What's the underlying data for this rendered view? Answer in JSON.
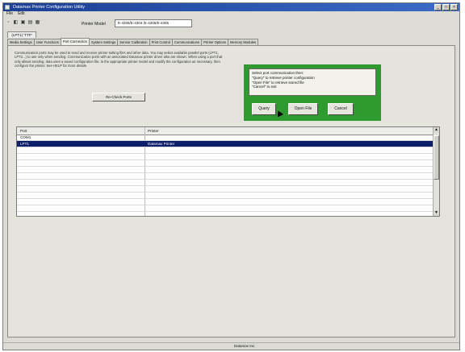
{
  "window": {
    "title": "Datamax Printer Configuration Utility",
    "controls": [
      "_",
      "□",
      "×"
    ]
  },
  "menu": [
    "File",
    "Edit"
  ],
  "toolbar": {
    "icons": [
      "new-icon",
      "open-icon",
      "save-icon",
      "print-icon",
      "properties-icon"
    ],
    "printer_model_label": "Printer Model",
    "printer_model_value": "E-4205/E-4304 /E-4206/E-4305"
  },
  "device_tab": "(LPT1) 'TTP'",
  "tabs": [
    "Media Settings",
    "User Functions",
    "Port Connection",
    "System Settings",
    "Sensor Calibration",
    "Print Control",
    "Communications",
    "Printer Options",
    "Memory Modules"
  ],
  "active_tab_index": 2,
  "panel": {
    "description": "Communication ports may be used to send and receive printer setting files and other data. You may select available parallel ports (LPT1, LPT2...) to use only when sending. Communication ports with an associated Datamax printer driver also are shown. When using a port that only allows sending, data uses a saved configuration file, to the appropriate printer model and modify the configuration as necessary, then configure the printer. See HELP for more details.",
    "recheck_button": "Re-Check Ports"
  },
  "dialog": {
    "message_lines": [
      "Select port communication then:",
      "\"Query\" to retrieve printer configuration",
      "\"Open File\" to retrieve stored file",
      "\"Cancel\" to exit"
    ],
    "buttons": [
      "Query",
      "Open File",
      "Cancel"
    ]
  },
  "ports_table": {
    "columns": [
      "Port",
      "Printer"
    ],
    "rows": [
      {
        "port": "COM1",
        "printer": ""
      },
      {
        "port": "LPT1",
        "printer": "Datamax Printer"
      },
      {
        "port": "",
        "printer": ""
      },
      {
        "port": "",
        "printer": ""
      },
      {
        "port": "",
        "printer": ""
      },
      {
        "port": "",
        "printer": ""
      },
      {
        "port": "",
        "printer": ""
      },
      {
        "port": "",
        "printer": ""
      },
      {
        "port": "",
        "printer": ""
      },
      {
        "port": "",
        "printer": ""
      },
      {
        "port": "",
        "printer": ""
      },
      {
        "port": "",
        "printer": ""
      }
    ],
    "selected_row_index": 1
  },
  "status_bar": "Datamax Inc.",
  "colors": {
    "title_bar": "#1c3f94",
    "dialog_frame": "#2f9a30",
    "selection": "#0b1f6b",
    "window_bg": "#dcdcd4"
  }
}
